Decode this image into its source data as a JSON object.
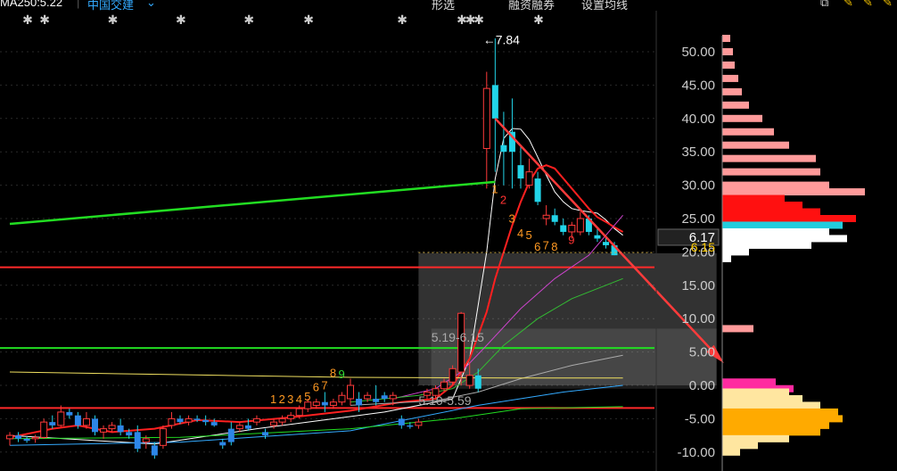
{
  "toolbar": {
    "ma_label": "MA250:5.22",
    "selector": "中国交建",
    "menu_items": [
      "形选",
      "融资融券",
      "设置均线"
    ]
  },
  "chart_data": {
    "type": "candlestick",
    "y_ticks": [
      "50.00",
      "45.00",
      "40.00",
      "35.00",
      "30.00",
      "25.00",
      "20.00",
      "15.00",
      "10.00",
      "5.00",
      "0.00",
      "-5.00",
      "-10.00"
    ],
    "ylim": [
      -11.5,
      55
    ],
    "candles": [
      {
        "o": -8,
        "h": -7,
        "l": -9,
        "c": -7.5
      },
      {
        "o": -7.5,
        "h": -7,
        "l": -8.5,
        "c": -8
      },
      {
        "o": -8,
        "h": -7.6,
        "l": -8.6,
        "c": -8.3
      },
      {
        "o": -8,
        "h": -7.4,
        "l": -8.6,
        "c": -7.8
      },
      {
        "o": -7.8,
        "h": -5,
        "l": -8,
        "c": -5.5
      },
      {
        "o": -5.5,
        "h": -4.5,
        "l": -6.5,
        "c": -6
      },
      {
        "o": -6,
        "h": -3,
        "l": -6.2,
        "c": -4
      },
      {
        "o": -4,
        "h": -3.5,
        "l": -5,
        "c": -4.5
      },
      {
        "o": -4.5,
        "h": -4,
        "l": -6.5,
        "c": -6
      },
      {
        "o": -6,
        "h": -4,
        "l": -6.5,
        "c": -5
      },
      {
        "o": -5,
        "h": -4.5,
        "l": -7.5,
        "c": -7
      },
      {
        "o": -7,
        "h": -6,
        "l": -8,
        "c": -6.5
      },
      {
        "o": -6.5,
        "h": -5.5,
        "l": -7,
        "c": -6
      },
      {
        "o": -6,
        "h": -5,
        "l": -7.5,
        "c": -7
      },
      {
        "o": -7,
        "h": -6.5,
        "l": -8,
        "c": -7.5
      },
      {
        "o": -7,
        "h": -6,
        "l": -10,
        "c": -9.5
      },
      {
        "o": -8.5,
        "h": -7.5,
        "l": -9.5,
        "c": -8
      },
      {
        "o": -9,
        "h": -8.5,
        "l": -11,
        "c": -10.5
      },
      {
        "o": -9,
        "h": -6,
        "l": -9.5,
        "c": -6.5
      },
      {
        "o": -6,
        "h": -4,
        "l": -6.5,
        "c": -5
      },
      {
        "o": -5,
        "h": -4.5,
        "l": -5.8,
        "c": -5.5
      },
      {
        "o": -5.5,
        "h": -4.5,
        "l": -6,
        "c": -5
      },
      {
        "o": -5,
        "h": -4.5,
        "l": -5.5,
        "c": -5.2
      },
      {
        "o": -5.2,
        "h": -4.5,
        "l": -6,
        "c": -5.5
      },
      {
        "o": -5.5,
        "h": -5,
        "l": -6.2,
        "c": -6
      },
      {
        "o": -8.5,
        "h": -8,
        "l": -9.5,
        "c": -9
      },
      {
        "o": -6.5,
        "h": -5.5,
        "l": -9,
        "c": -8.5
      },
      {
        "o": -6.5,
        "h": -5.5,
        "l": -7,
        "c": -6
      },
      {
        "o": -6,
        "h": -5,
        "l": -6.8,
        "c": -6.5
      },
      {
        "o": -5.5,
        "h": -4.5,
        "l": -6,
        "c": -5
      },
      {
        "o": -7,
        "h": -6.5,
        "l": -8,
        "c": -7.5
      },
      {
        "o": -6,
        "h": -5,
        "l": -6.5,
        "c": -5.5
      },
      {
        "o": -5.5,
        "h": -4.5,
        "l": -6,
        "c": -5
      },
      {
        "o": -5,
        "h": -4,
        "l": -5.5,
        "c": -4.5
      },
      {
        "o": -4.5,
        "h": -3,
        "l": -5,
        "c": -3.5
      },
      {
        "o": -3.5,
        "h": -2,
        "l": -4,
        "c": -2.5
      },
      {
        "o": -3,
        "h": -2,
        "l": -3.5,
        "c": -2.5
      },
      {
        "o": -2.5,
        "h": -1,
        "l": -4,
        "c": -3
      },
      {
        "o": -3,
        "h": -2,
        "l": -3.5,
        "c": -2.5
      },
      {
        "o": -2.5,
        "h": -1,
        "l": -3,
        "c": -1.5
      },
      {
        "o": -2,
        "h": 1,
        "l": -3,
        "c": 0
      },
      {
        "o": -2,
        "h": -1,
        "l": -4,
        "c": -3
      },
      {
        "o": -2,
        "h": -1,
        "l": -2.5,
        "c": -1.5
      },
      {
        "o": -2,
        "h": 0,
        "l": -3,
        "c": -2.5
      },
      {
        "o": -1.5,
        "h": -1,
        "l": -2.5,
        "c": -2
      },
      {
        "o": -2,
        "h": -1,
        "l": -3,
        "c": -1.5
      },
      {
        "o": -5,
        "h": -4.5,
        "l": -6.5,
        "c": -6
      },
      {
        "o": -6,
        "h": -5.5,
        "l": -6.5,
        "c": -6.2
      },
      {
        "o": -6,
        "h": -5,
        "l": -6.5,
        "c": -5.5
      },
      {
        "o": -1.5,
        "h": -0.5,
        "l": -2,
        "c": -1
      },
      {
        "o": -1.5,
        "h": 0,
        "l": -2,
        "c": -0.5
      },
      {
        "o": -0.5,
        "h": 1,
        "l": -1,
        "c": 0.5
      },
      {
        "o": 0.5,
        "h": 3,
        "l": 0,
        "c": 2.5
      },
      {
        "o": 2,
        "h": 11,
        "l": 0,
        "c": 10.8
      },
      {
        "o": 0,
        "h": 3.5,
        "l": -0.5,
        "c": 1.5
      },
      {
        "o": 1.5,
        "h": 2.5,
        "l": -1,
        "c": -0.5
      },
      {
        "o": 35.5,
        "h": 47,
        "l": 29.5,
        "c": 44.5
      },
      {
        "o": 45,
        "h": 52,
        "l": 32,
        "c": 40
      },
      {
        "o": 36,
        "h": 41,
        "l": 30,
        "c": 35
      },
      {
        "o": 38,
        "h": 43,
        "l": 29.5,
        "c": 35
      },
      {
        "o": 33,
        "h": 36,
        "l": 29.5,
        "c": 31
      },
      {
        "o": 30,
        "h": 34,
        "l": 29.5,
        "c": 32
      },
      {
        "o": 31,
        "h": 32,
        "l": 27,
        "c": 27.5
      },
      {
        "o": 25,
        "h": 27,
        "l": 24,
        "c": 25.5
      },
      {
        "o": 25.5,
        "h": 26.5,
        "l": 24,
        "c": 24.5
      },
      {
        "o": 24,
        "h": 25,
        "l": 22.5,
        "c": 23
      },
      {
        "o": 23,
        "h": 24.5,
        "l": 22,
        "c": 24
      },
      {
        "o": 23,
        "h": 26,
        "l": 22.5,
        "c": 25
      },
      {
        "o": 25,
        "h": 25.5,
        "l": 22.5,
        "c": 23
      },
      {
        "o": 22.5,
        "h": 23.5,
        "l": 21.5,
        "c": 22
      },
      {
        "o": 21.5,
        "h": 22.5,
        "l": 20.5,
        "c": 21
      },
      {
        "o": 21,
        "h": 21.5,
        "l": 19.5,
        "c": 19.5
      }
    ],
    "price_labels": [
      {
        "text": "←7.84",
        "v": 51.8
      },
      {
        "text": "5.19-6.15",
        "v": 7.2
      },
      {
        "text": "5.10-5.59",
        "v": -2.3
      }
    ],
    "current_price_box": {
      "text": "6.17",
      "v": 22.2
    },
    "price_label_2": {
      "text": "6.15",
      "v": 20.7
    },
    "count_labels": [
      {
        "text": "1",
        "v": -2.7,
        "c": "#ff9922"
      },
      {
        "text": "2",
        "v": -2.7,
        "c": "#ff9922"
      },
      {
        "text": "3",
        "v": -2.7,
        "c": "#ff9922"
      },
      {
        "text": "4",
        "v": -2.7,
        "c": "#ff9922"
      },
      {
        "text": "5",
        "v": -2.3,
        "c": "#ff9922"
      },
      {
        "text": "6",
        "v": -0.9,
        "c": "#ff9922"
      },
      {
        "text": "7",
        "v": -0.6,
        "c": "#ff9922"
      },
      {
        "text": "8",
        "v": 1.3,
        "c": "#ff9922"
      },
      {
        "text": "9",
        "v": 1.1,
        "c": "#33dd33"
      },
      {
        "text": "1",
        "v": 28.8,
        "c": "#ff9922"
      },
      {
        "text": "2",
        "v": 27.2,
        "c": "#ff3333"
      },
      {
        "text": "3",
        "v": 24.4,
        "c": "#ff9922"
      },
      {
        "text": "4",
        "v": 22.2,
        "c": "#ff9922"
      },
      {
        "text": "5",
        "v": 21.9,
        "c": "#ff9922"
      },
      {
        "text": "6",
        "v": 20.2,
        "c": "#ff9922"
      },
      {
        "text": "7",
        "v": 20.4,
        "c": "#ff9922"
      },
      {
        "text": "8",
        "v": 20.2,
        "c": "#ff9922"
      },
      {
        "text": "9",
        "v": 21.2,
        "c": "#ff3333"
      }
    ],
    "reference_lines": [
      {
        "color": "#ff2a2a",
        "v": 17.7
      },
      {
        "color": "#22dd22",
        "v": 5.6
      },
      {
        "color": "#ff2a2a",
        "v": -3.4
      }
    ],
    "trend_lines": [
      {
        "color": "#22dd22",
        "from": {
          "x": 0,
          "v": 24.2
        },
        "to": {
          "x": 57,
          "v": 30.5
        }
      },
      {
        "color": "#ff3b3b",
        "from": {
          "x": 57,
          "v": 40
        },
        "to": {
          "x": 83,
          "v": 4.5
        }
      }
    ],
    "moving_averages": [
      {
        "color": "#ffffff",
        "points": [
          [
            0,
            -7.5
          ],
          [
            17,
            -8.8
          ],
          [
            29,
            -6.5
          ],
          [
            44,
            -4
          ],
          [
            52,
            -2
          ],
          [
            54,
            4
          ],
          [
            56,
            20
          ],
          [
            57,
            31
          ],
          [
            58,
            37
          ],
          [
            59,
            38.5
          ],
          [
            60,
            38.4
          ],
          [
            61,
            36.8
          ],
          [
            62,
            34.2
          ],
          [
            63,
            31.5
          ],
          [
            64,
            29
          ],
          [
            65,
            27.5
          ],
          [
            66,
            26.5
          ],
          [
            67,
            26.2
          ],
          [
            68,
            26
          ],
          [
            69,
            25.8
          ],
          [
            70,
            24.8
          ],
          [
            71,
            23.5
          ],
          [
            72,
            22.5
          ]
        ]
      },
      {
        "color": "#ff2020",
        "points": [
          [
            0,
            -7.8
          ],
          [
            5,
            -6.5
          ],
          [
            8,
            -6
          ],
          [
            12,
            -7
          ],
          [
            17,
            -6.5
          ],
          [
            22,
            -5.2
          ],
          [
            27,
            -5.5
          ],
          [
            33,
            -4.8
          ],
          [
            40,
            -3.8
          ],
          [
            46,
            -2.5
          ],
          [
            50,
            -2
          ],
          [
            52,
            0
          ],
          [
            54,
            4
          ],
          [
            56,
            11
          ],
          [
            57,
            16
          ],
          [
            58,
            20
          ],
          [
            59,
            24
          ],
          [
            60,
            27.5
          ],
          [
            61,
            30.5
          ],
          [
            62,
            32.5
          ],
          [
            63,
            33
          ],
          [
            64,
            32.5
          ],
          [
            65,
            31
          ],
          [
            66,
            29.5
          ],
          [
            67,
            28
          ],
          [
            68,
            26.5
          ],
          [
            69,
            25.2
          ],
          [
            70,
            24.5
          ],
          [
            71,
            23.7
          ],
          [
            72,
            23
          ]
        ]
      },
      {
        "color": "#cc44cc",
        "points": [
          [
            45,
            -2
          ],
          [
            50,
            -0.5
          ],
          [
            53,
            2
          ],
          [
            56,
            6
          ],
          [
            60,
            11.5
          ],
          [
            64,
            16
          ],
          [
            68,
            19.5
          ],
          [
            72,
            25.5
          ]
        ]
      },
      {
        "color": "#33bb33",
        "points": [
          [
            40,
            -2.5
          ],
          [
            48,
            -1.5
          ],
          [
            52,
            -0.5
          ],
          [
            55,
            2
          ],
          [
            58,
            6
          ],
          [
            62,
            10
          ],
          [
            66,
            13
          ],
          [
            70,
            15
          ],
          [
            72,
            16
          ]
        ]
      },
      {
        "color": "#aaaaaa",
        "points": [
          [
            40,
            -3
          ],
          [
            50,
            -2.3
          ],
          [
            55,
            -1
          ],
          [
            60,
            1
          ],
          [
            66,
            3
          ],
          [
            72,
            4.5
          ]
        ]
      },
      {
        "color": "#f0e060",
        "points": [
          [
            0,
            2
          ],
          [
            20,
            1.6
          ],
          [
            40,
            1.2
          ],
          [
            60,
            1.1
          ],
          [
            72,
            1.1
          ]
        ]
      },
      {
        "color": "#33aaff",
        "points": [
          [
            0,
            -9
          ],
          [
            20,
            -8.5
          ],
          [
            40,
            -6.8
          ],
          [
            55,
            -3
          ],
          [
            65,
            -1
          ],
          [
            72,
            0
          ]
        ]
      },
      {
        "color": "#22dd22",
        "points": [
          [
            0,
            -8
          ],
          [
            20,
            -7.8
          ],
          [
            40,
            -6.5
          ],
          [
            52,
            -5
          ],
          [
            60,
            -3.5
          ],
          [
            72,
            -3.2
          ]
        ]
      }
    ],
    "shaded_zones": [
      {
        "x0": 48,
        "x1": 83,
        "vtop": 19.8,
        "vbot": 0,
        "color": "rgba(200,200,200,0.25)"
      },
      {
        "x0": 49.5,
        "x1": 83,
        "vtop": 8.5,
        "vbot": -0.5,
        "color": "rgba(160,160,160,0.18)"
      }
    ],
    "volume_profile": {
      "rows": [
        {
          "v": 52,
          "w": 9,
          "c": "#ff9a9a"
        },
        {
          "v": 50,
          "w": 12,
          "c": "#ff9a9a"
        },
        {
          "v": 48,
          "w": 14,
          "c": "#ff9a9a"
        },
        {
          "v": 46,
          "w": 18,
          "c": "#ff9a9a"
        },
        {
          "v": 44,
          "w": 22,
          "c": "#ff9a9a"
        },
        {
          "v": 42,
          "w": 30,
          "c": "#ff9a9a"
        },
        {
          "v": 40,
          "w": 45,
          "c": "#ff9a9a"
        },
        {
          "v": 38,
          "w": 58,
          "c": "#ff9a9a"
        },
        {
          "v": 36,
          "w": 75,
          "c": "#ff9a9a"
        },
        {
          "v": 34,
          "w": 105,
          "c": "#ff9a9a"
        },
        {
          "v": 32,
          "w": 110,
          "c": "#ff9a9a"
        },
        {
          "v": 30,
          "w": 120,
          "c": "#ff9a9a"
        },
        {
          "v": 29,
          "w": 160,
          "c": "#ff9a9a"
        },
        {
          "v": 28,
          "w": 70,
          "c": "#ff1010"
        },
        {
          "v": 27,
          "w": 90,
          "c": "#ff1010"
        },
        {
          "v": 26,
          "w": 110,
          "c": "#ff1010"
        },
        {
          "v": 25,
          "w": 150,
          "c": "#ff1010"
        },
        {
          "v": 24,
          "w": 135,
          "c": "#22ccdd"
        },
        {
          "v": 23,
          "w": 120,
          "c": "#ffffff"
        },
        {
          "v": 22,
          "w": 140,
          "c": "#ffffff"
        },
        {
          "v": 21,
          "w": 100,
          "c": "#ffffff"
        },
        {
          "v": 20,
          "w": 30,
          "c": "#ffffff"
        },
        {
          "v": 19,
          "w": 10,
          "c": "#ffffff"
        },
        {
          "v": 8.5,
          "w": 35,
          "c": "#ff9a9a"
        },
        {
          "v": 0.5,
          "w": 60,
          "c": "#ff2aa0"
        },
        {
          "v": -0.5,
          "w": 80,
          "c": "#ff2aa0"
        },
        {
          "v": -1,
          "w": 75,
          "c": "#ffe6a0"
        },
        {
          "v": -2,
          "w": 90,
          "c": "#ffe6a0"
        },
        {
          "v": -3,
          "w": 110,
          "c": "#ffe6a0"
        },
        {
          "v": -4,
          "w": 130,
          "c": "#ffaa00"
        },
        {
          "v": -5,
          "w": 135,
          "c": "#ffaa00"
        },
        {
          "v": -6,
          "w": 120,
          "c": "#ffaa00"
        },
        {
          "v": -7,
          "w": 110,
          "c": "#ffaa00"
        },
        {
          "v": -8,
          "w": 75,
          "c": "#ffe6a0"
        },
        {
          "v": -9,
          "w": 40,
          "c": "#ffe6a0"
        },
        {
          "v": -10,
          "w": 20,
          "c": "#ffe6a0"
        }
      ]
    },
    "event_markers": [
      2,
      4,
      12,
      20,
      28,
      35,
      46,
      53,
      54,
      55,
      62
    ]
  }
}
